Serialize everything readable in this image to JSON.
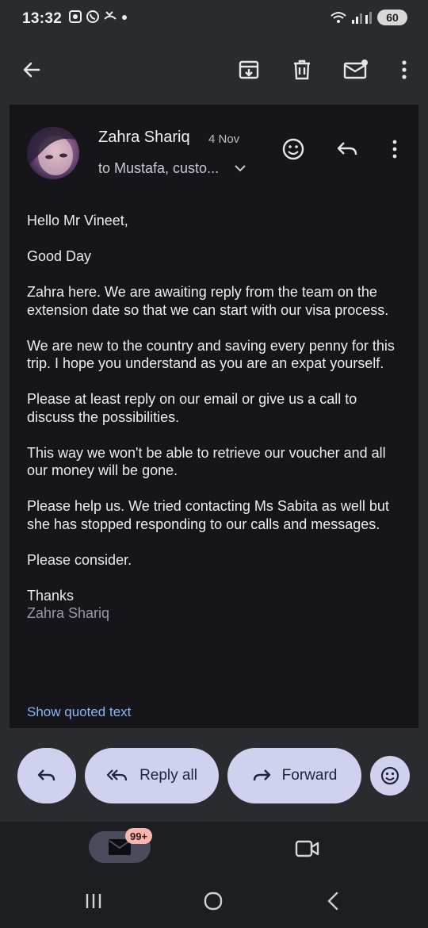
{
  "status_bar": {
    "time": "13:32",
    "battery": "60"
  },
  "toolbar": {
    "back_icon": "arrow-left-icon",
    "archive_icon": "archive-icon",
    "delete_icon": "trash-icon",
    "mark_unread_icon": "mail-unread-icon",
    "more_icon": "more-vert-icon"
  },
  "email": {
    "sender": "Zahra Shariq",
    "date": "4 Nov",
    "recipients": "to Mustafa, custo...",
    "body": [
      "Hello Mr Vineet,",
      "Good Day",
      "Zahra here. We are awaiting reply from the team on the extension date so that we can start with our visa process.",
      "We are new to the country and saving every penny for this trip. I hope you understand as you are an expat yourself.",
      "Please at least reply on our email or give us a call to discuss the possibilities.",
      "This way we won't be able to retrieve our voucher and all our money will be gone.",
      "Please help us. We tried contacting Ms Sabita as well but she has stopped responding to our calls and messages.",
      "Please consider."
    ],
    "signoff": "Thanks",
    "signature": "Zahra Shariq",
    "show_quoted": "Show quoted text"
  },
  "actions": {
    "reply_all": "Reply all",
    "forward": "Forward"
  },
  "bottom_nav": {
    "mail_badge": "99+"
  },
  "colors": {
    "accent_link": "#8ab4f8",
    "pill_bg": "#cfd1ee",
    "card_bg": "#16161a"
  }
}
